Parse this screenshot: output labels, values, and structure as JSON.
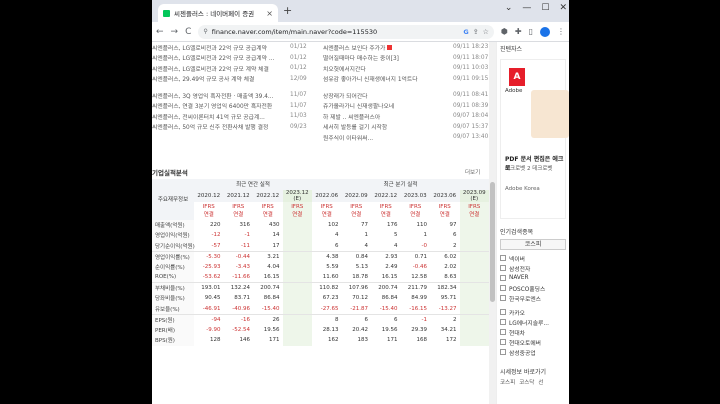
{
  "browser": {
    "tab_title": "씨젠플러스 : 네이버페이 증권",
    "tab_close": "×",
    "new_tab": "+",
    "window_controls": [
      "⌄",
      "—",
      "☐",
      "✕"
    ],
    "url": "finance.naver.com/item/main.naver?code=115530",
    "nav_back": "←",
    "nav_forward": "→",
    "nav_reload": "C",
    "google_icon_text": "G"
  },
  "news": {
    "rows": [
      {
        "t": "씨엔플러스, LG엘로비전과 22억 규모 공급계약",
        "d": "01/12",
        "t2": "씨엔플러스 보인다 주가가",
        "d2": "09/11 18:23",
        "red": true
      },
      {
        "t": "씨엔플러스, LG엘로비전과 22억 규모 공급계약 ...",
        "d": "01/12",
        "t2": "떨어질때마다 매수하는 중이[3]",
        "d2": "09/11 18:07",
        "red": false
      },
      {
        "t": "씨엔플러스, LG엘로비전과 22억 규모 계약 체결",
        "d": "01/12",
        "t2": "치오헛에서지간다",
        "d2": "09/11 10:03",
        "red": false
      },
      {
        "t": "씨엔플러스, 29.49억 규모 공사 계약 체결",
        "d": "12/09",
        "t2": "섬유감 좋아가니 신재생에너지 1억트다",
        "d2": "09/11 09:15",
        "red": false
      }
    ],
    "rows2": [
      {
        "t": "씨엔플러스, 3Q 영업익 흑자전환 · 매출액 39.4...",
        "d": "11/07",
        "t2": "상장래가 되어간다",
        "d2": "09/11 08:41"
      },
      {
        "t": "씨엔플러스, 연결 3분기 영업익 6400만 흑자전환",
        "d": "11/07",
        "t2": "쥬가올라가니 신재생팔나오네",
        "d2": "09/11 08:39"
      },
      {
        "t": "씨엔플러스, 전씨이론터치 41억 규모 공급계...",
        "d": "11/03",
        "t2": "하 제발 .. 씨엔플러스아",
        "d2": "09/07 18:04"
      },
      {
        "t": "씨엔플러스, 50억 규모 신주 전환사채 발행 결정",
        "d": "09/23",
        "t2": "세서히 발등를 걸기 시작함",
        "d2": "09/07 15:37"
      },
      {
        "t": "",
        "d": "",
        "t2": "원주식이 이타워써...",
        "d2": "09/07 13:40"
      }
    ]
  },
  "finance": {
    "title": "기업실적분석",
    "more": "더보기",
    "label_header": "주요재무정보",
    "annual_header": "최근 연간 실적",
    "quarter_header": "최근 분기 실적",
    "periods": [
      "2020.12",
      "2021.12",
      "2022.12",
      "2023.12",
      "2022.06",
      "2022.09",
      "2022.12",
      "2023.03",
      "2023.06",
      "2023.09"
    ],
    "estimate_marks": [
      "",
      "",
      "",
      "(E)",
      "",
      "",
      "",
      "",
      "",
      "(E)"
    ],
    "ifrs": "IFRS",
    "basis": "연결",
    "rows": [
      {
        "label": "매출액(억원)",
        "v": [
          "220",
          "316",
          "430",
          "",
          "102",
          "77",
          "176",
          "110",
          "97",
          ""
        ]
      },
      {
        "label": "영업이익(억원)",
        "v": [
          "-12",
          "-1",
          "14",
          "",
          "4",
          "1",
          "5",
          "1",
          "6",
          ""
        ]
      },
      {
        "label": "당기순이익(억원)",
        "v": [
          "-57",
          "-11",
          "17",
          "",
          "6",
          "4",
          "4",
          "-0",
          "2",
          ""
        ]
      },
      {
        "label": "영업이익률(%)",
        "v": [
          "-5.30",
          "-0.44",
          "3.21",
          "",
          "4.38",
          "0.84",
          "2.93",
          "0.71",
          "6.02",
          ""
        ]
      },
      {
        "label": "순이익률(%)",
        "v": [
          "-25.93",
          "-3.43",
          "4.04",
          "",
          "5.59",
          "5.13",
          "2.49",
          "-0.46",
          "2.02",
          ""
        ]
      },
      {
        "label": "ROE(%)",
        "v": [
          "-53.62",
          "-11.66",
          "16.15",
          "",
          "11.60",
          "18.78",
          "16.15",
          "12.58",
          "8.63",
          ""
        ]
      },
      {
        "label": "부채비율(%)",
        "v": [
          "193.01",
          "132.24",
          "200.74",
          "",
          "110.82",
          "107.96",
          "200.74",
          "211.79",
          "182.34",
          ""
        ]
      },
      {
        "label": "당좌비율(%)",
        "v": [
          "90.45",
          "83.71",
          "86.84",
          "",
          "67.23",
          "70.12",
          "86.84",
          "84.99",
          "95.71",
          ""
        ]
      },
      {
        "label": "유보율(%)",
        "v": [
          "-46.91",
          "-40.96",
          "-15.40",
          "",
          "-27.65",
          "-21.87",
          "-15.40",
          "-16.15",
          "-13.27",
          ""
        ]
      },
      {
        "label": "EPS(원)",
        "v": [
          "-94",
          "-16",
          "26",
          "",
          "8",
          "6",
          "6",
          "-1",
          "2",
          ""
        ]
      },
      {
        "label": "PER(배)",
        "v": [
          "-9.90",
          "-52.54",
          "19.56",
          "",
          "28.13",
          "20.42",
          "19.56",
          "29.39",
          "34.21",
          ""
        ]
      },
      {
        "label": "BPS(원)",
        "v": [
          "128",
          "146",
          "171",
          "",
          "162",
          "183",
          "171",
          "168",
          "172",
          ""
        ]
      }
    ]
  },
  "sidebar": {
    "top_title": "진텐자스",
    "ad": {
      "brand": "Adobe",
      "headline": "PDF 문서 편집은 에크로",
      "sub": "에크로벳 2 데크로벳",
      "company": "Adobe Korea"
    },
    "popular_title": "인기검색종목",
    "popular_tab": "코스피",
    "popular_items": [
      "넥이버",
      "삼성전자",
      "NAVER",
      "POSCO홀딩스",
      "한국무로엔스"
    ],
    "popular_items2": [
      "카카오",
      "LG에너지솔루...",
      "현대차",
      "현대오토에버",
      "삼성중공업"
    ],
    "related_title": "시세정보 바로가기",
    "related_items": [
      "코스피",
      "코스닥",
      "선"
    ]
  }
}
